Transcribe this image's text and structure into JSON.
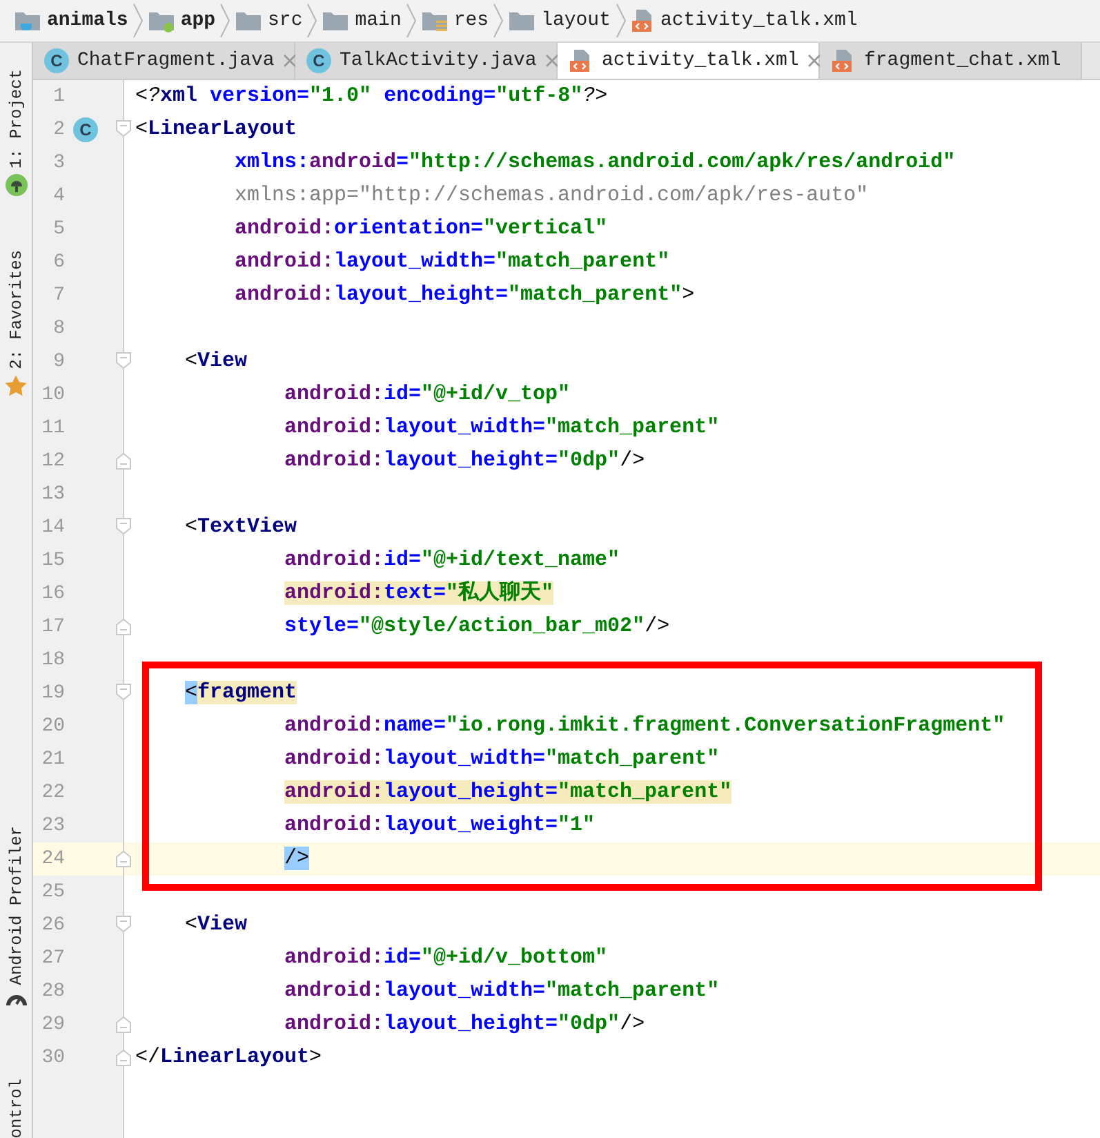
{
  "breadcrumbs": [
    {
      "label": "animals",
      "kind": "project",
      "bold": true
    },
    {
      "label": "app",
      "kind": "module",
      "bold": true
    },
    {
      "label": "src",
      "kind": "folder",
      "bold": false
    },
    {
      "label": "main",
      "kind": "folder",
      "bold": false
    },
    {
      "label": "res",
      "kind": "resources",
      "bold": false
    },
    {
      "label": "layout",
      "kind": "folder",
      "bold": false
    },
    {
      "label": "activity_talk.xml",
      "kind": "file",
      "bold": false
    }
  ],
  "tool_strip": {
    "top": [
      {
        "label": "1: Project",
        "kind": "android"
      },
      {
        "label": "2: Favorites",
        "kind": "star"
      }
    ],
    "bottom": [
      {
        "label": "Android Profiler",
        "kind": "gauge"
      },
      {
        "label": "ontrol",
        "kind": "text-only"
      }
    ]
  },
  "tabs": [
    {
      "label": "ChatFragment.java",
      "kind": "java",
      "badge": "C",
      "selected": false,
      "closable": true
    },
    {
      "label": "TalkActivity.java",
      "kind": "java",
      "badge": "C",
      "selected": false,
      "closable": true
    },
    {
      "label": "activity_talk.xml",
      "kind": "xml",
      "selected": true,
      "closable": true
    },
    {
      "label": "fragment_chat.xml",
      "kind": "xml",
      "selected": false,
      "closable": false
    }
  ],
  "editor": {
    "lines": [
      {
        "number": "1",
        "kind": "declaration",
        "current": false,
        "tokens": [
          {
            "t": "<?",
            "kind": "pi",
            "highlighted": false
          },
          {
            "t": "xml",
            "kind": "tag",
            "highlighted": false
          },
          {
            "t": " version=",
            "kind": "attr",
            "highlighted": false
          },
          {
            "t": "\"1.0\"",
            "kind": "value",
            "highlighted": false
          },
          {
            "t": " encoding=",
            "kind": "attr",
            "highlighted": false
          },
          {
            "t": "\"utf-8\"",
            "kind": "value",
            "highlighted": false
          },
          {
            "t": "?>",
            "kind": "pi",
            "highlighted": false
          }
        ]
      },
      {
        "number": "2",
        "kind": "tag",
        "current": false,
        "badge": "C",
        "tokens": [
          {
            "t": "<",
            "kind": "punct",
            "highlighted": false
          },
          {
            "t": "LinearLayout",
            "kind": "tag",
            "highlighted": false
          }
        ],
        "children": [
          {
            "number": "3",
            "kind": "attribute",
            "current": false,
            "tokens": [
              {
                "t": "xmlns:",
                "kind": "attr",
                "highlighted": false
              },
              {
                "t": "android",
                "kind": "ns",
                "highlighted": false
              },
              {
                "t": "=",
                "kind": "attr",
                "highlighted": false
              },
              {
                "t": "\"http://schemas.android.com/apk/res/android\"",
                "kind": "value",
                "highlighted": false
              }
            ]
          },
          {
            "number": "4",
            "kind": "attribute",
            "current": false,
            "tokens": [
              {
                "t": "xmlns:app=\"http://schemas.android.com/apk/res-auto\"",
                "kind": "dim",
                "highlighted": false
              }
            ]
          },
          {
            "number": "5",
            "kind": "attribute",
            "current": false,
            "tokens": [
              {
                "t": "android:",
                "kind": "ns",
                "highlighted": false
              },
              {
                "t": "orientation=",
                "kind": "attr",
                "highlighted": false
              },
              {
                "t": "\"vertical\"",
                "kind": "value",
                "highlighted": false
              }
            ]
          },
          {
            "number": "6",
            "kind": "attribute",
            "current": false,
            "tokens": [
              {
                "t": "android:",
                "kind": "ns",
                "highlighted": false
              },
              {
                "t": "layout_width=",
                "kind": "attr",
                "highlighted": false
              },
              {
                "t": "\"match_parent\"",
                "kind": "value",
                "highlighted": false
              }
            ]
          },
          {
            "number": "7",
            "kind": "attribute",
            "current": false,
            "tokens": [
              {
                "t": "android:",
                "kind": "ns",
                "highlighted": false
              },
              {
                "t": "layout_height=",
                "kind": "attr",
                "highlighted": false
              },
              {
                "t": "\"match_parent\"",
                "kind": "value",
                "highlighted": false
              },
              {
                "t": ">",
                "kind": "punct",
                "highlighted": false
              }
            ]
          },
          {
            "number": "8",
            "kind": "blank",
            "current": false
          },
          {
            "number": "9",
            "kind": "tag",
            "current": false,
            "tokens": [
              {
                "t": "<",
                "kind": "punct",
                "highlighted": false
              },
              {
                "t": "View",
                "kind": "tag",
                "highlighted": false
              }
            ],
            "children": [
              {
                "number": "10",
                "kind": "attribute",
                "current": false,
                "tokens": [
                  {
                    "t": "android:",
                    "kind": "ns",
                    "highlighted": false
                  },
                  {
                    "t": "id=",
                    "kind": "attr",
                    "highlighted": false
                  },
                  {
                    "t": "\"@+id/v_top\"",
                    "kind": "value",
                    "highlighted": false
                  }
                ]
              },
              {
                "number": "11",
                "kind": "attribute",
                "current": false,
                "tokens": [
                  {
                    "t": "android:",
                    "kind": "ns",
                    "highlighted": false
                  },
                  {
                    "t": "layout_width=",
                    "kind": "attr",
                    "highlighted": false
                  },
                  {
                    "t": "\"match_parent\"",
                    "kind": "value",
                    "highlighted": false
                  }
                ]
              },
              {
                "number": "12",
                "kind": "attribute",
                "current": false,
                "tokens": [
                  {
                    "t": "android:",
                    "kind": "ns",
                    "highlighted": false
                  },
                  {
                    "t": "layout_height=",
                    "kind": "attr",
                    "highlighted": false
                  },
                  {
                    "t": "\"0dp\"",
                    "kind": "value",
                    "highlighted": false
                  },
                  {
                    "t": "/>",
                    "kind": "punct",
                    "highlighted": false
                  }
                ]
              }
            ]
          },
          {
            "number": "13",
            "kind": "blank",
            "current": false
          },
          {
            "number": "14",
            "kind": "tag",
            "current": false,
            "tokens": [
              {
                "t": "<",
                "kind": "punct",
                "highlighted": false
              },
              {
                "t": "TextView",
                "kind": "tag",
                "highlighted": false
              }
            ],
            "children": [
              {
                "number": "15",
                "kind": "attribute",
                "current": false,
                "tokens": [
                  {
                    "t": "android:",
                    "kind": "ns",
                    "highlighted": false
                  },
                  {
                    "t": "id=",
                    "kind": "attr",
                    "highlighted": false
                  },
                  {
                    "t": "\"@+id/text_name\"",
                    "kind": "value",
                    "highlighted": false
                  }
                ]
              },
              {
                "number": "16",
                "kind": "attribute",
                "current": false,
                "tokens": [
                  {
                    "t": "android:",
                    "kind": "ns",
                    "highlighted": true
                  },
                  {
                    "t": "text=",
                    "kind": "attr",
                    "highlighted": true
                  },
                  {
                    "t": "\"私人聊天\"",
                    "kind": "value",
                    "highlighted": true
                  }
                ]
              },
              {
                "number": "17",
                "kind": "attribute",
                "current": false,
                "tokens": [
                  {
                    "t": "style=",
                    "kind": "attr",
                    "highlighted": false
                  },
                  {
                    "t": "\"@style/action_bar_m02\"",
                    "kind": "value",
                    "highlighted": false
                  },
                  {
                    "t": "/>",
                    "kind": "punct",
                    "highlighted": false
                  }
                ]
              }
            ]
          },
          {
            "number": "18",
            "kind": "blank",
            "current": false
          },
          {
            "number": "19",
            "kind": "tag",
            "current": false,
            "tokens": [
              {
                "t": "<",
                "kind": "punct",
                "highlighted": true
              },
              {
                "t": "fragment",
                "kind": "tag",
                "highlighted": true
              }
            ],
            "children": [
              {
                "number": "20",
                "kind": "attribute",
                "current": false,
                "tokens": [
                  {
                    "t": "android:",
                    "kind": "ns",
                    "highlighted": false
                  },
                  {
                    "t": "name=",
                    "kind": "attr",
                    "highlighted": false
                  },
                  {
                    "t": "\"io.rong.imkit.fragment.ConversationFragment\"",
                    "kind": "value",
                    "highlighted": false
                  }
                ]
              },
              {
                "number": "21",
                "kind": "attribute",
                "current": false,
                "tokens": [
                  {
                    "t": "android:",
                    "kind": "ns",
                    "highlighted": false
                  },
                  {
                    "t": "layout_width=",
                    "kind": "attr",
                    "highlighted": false
                  },
                  {
                    "t": "\"match_parent\"",
                    "kind": "value",
                    "highlighted": false
                  }
                ]
              },
              {
                "number": "22",
                "kind": "attribute",
                "current": false,
                "tokens": [
                  {
                    "t": "android:",
                    "kind": "ns",
                    "highlighted": true
                  },
                  {
                    "t": "layout_height=",
                    "kind": "attr",
                    "highlighted": true
                  },
                  {
                    "t": "\"match_parent\"",
                    "kind": "value",
                    "highlighted": true
                  }
                ]
              },
              {
                "number": "23",
                "kind": "attribute",
                "current": false,
                "tokens": [
                  {
                    "t": "android:",
                    "kind": "ns",
                    "highlighted": false
                  },
                  {
                    "t": "layout_weight=",
                    "kind": "attr",
                    "highlighted": false
                  },
                  {
                    "t": "\"1\"",
                    "kind": "value",
                    "highlighted": false
                  }
                ]
              },
              {
                "number": "24",
                "kind": "attribute",
                "current": true,
                "tokens": [
                  {
                    "t": "/>",
                    "kind": "punct",
                    "highlighted": true
                  }
                ]
              }
            ]
          },
          {
            "number": "25",
            "kind": "blank",
            "current": false
          },
          {
            "number": "26",
            "kind": "tag",
            "current": false,
            "tokens": [
              {
                "t": "<",
                "kind": "punct",
                "highlighted": false
              },
              {
                "t": "View",
                "kind": "tag",
                "highlighted": false
              }
            ],
            "children": [
              {
                "number": "27",
                "kind": "attribute",
                "current": false,
                "tokens": [
                  {
                    "t": "android:",
                    "kind": "ns",
                    "highlighted": false
                  },
                  {
                    "t": "id=",
                    "kind": "attr",
                    "highlighted": false
                  },
                  {
                    "t": "\"@+id/v_bottom\"",
                    "kind": "value",
                    "highlighted": false
                  }
                ]
              },
              {
                "number": "28",
                "kind": "attribute",
                "current": false,
                "tokens": [
                  {
                    "t": "android:",
                    "kind": "ns",
                    "highlighted": false
                  },
                  {
                    "t": "layout_width=",
                    "kind": "attr",
                    "highlighted": false
                  },
                  {
                    "t": "\"match_parent\"",
                    "kind": "value",
                    "highlighted": false
                  }
                ]
              },
              {
                "number": "29",
                "kind": "attribute",
                "current": false,
                "tokens": [
                  {
                    "t": "android:",
                    "kind": "ns",
                    "highlighted": false
                  },
                  {
                    "t": "layout_height=",
                    "kind": "attr",
                    "highlighted": false
                  },
                  {
                    "t": "\"0dp\"",
                    "kind": "value",
                    "highlighted": false
                  },
                  {
                    "t": "/>",
                    "kind": "punct",
                    "highlighted": false
                  }
                ]
              }
            ]
          }
        ]
      },
      {
        "number": "30",
        "kind": "closing-tag",
        "current": false,
        "tokens": [
          {
            "t": "</",
            "kind": "punct",
            "highlighted": false
          },
          {
            "t": "LinearLayout",
            "kind": "tag",
            "highlighted": false
          },
          {
            "t": ">",
            "kind": "punct",
            "highlighted": false
          }
        ]
      }
    ]
  }
}
